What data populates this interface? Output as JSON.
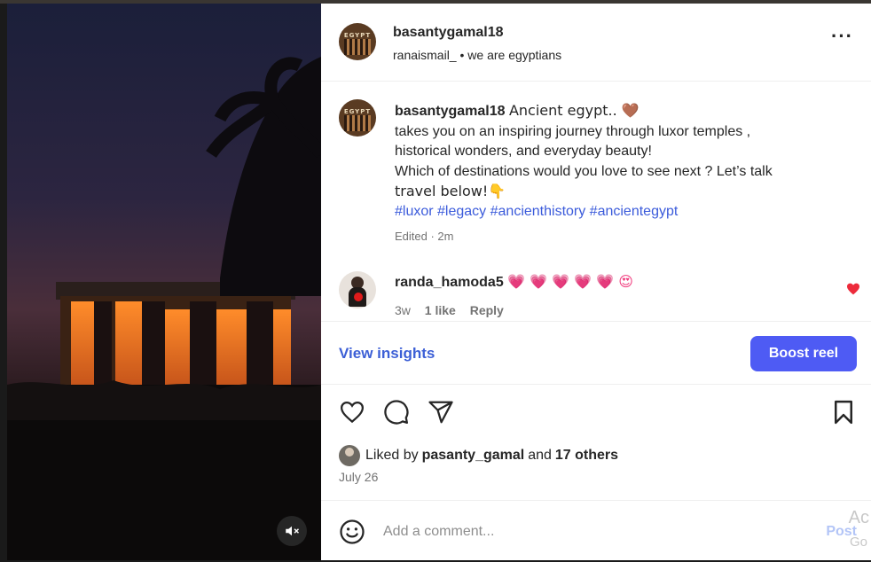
{
  "post_header": {
    "username": "basantygamal18",
    "audio_user": "ranaismail_",
    "audio_sep": "•",
    "audio_title": "we are egyptians",
    "avatar_text": "EGYPT"
  },
  "caption": {
    "username": "basantygamal18",
    "line1": "Ancient egypt.. 🤎",
    "line2": "takes you on an inspiring journey through luxor temples ,",
    "line3": "historical wonders, and everyday beauty!",
    "line4": "Which of destinations would you love to see next ? Let’s talk",
    "line5": "travel below!👇",
    "hashtags": "#luxor #legacy #ancienthistory #ancientegypt",
    "meta": "Edited · 2m"
  },
  "comment": {
    "username": "randa_hamoda5",
    "text": "💗 💗 💗 💗 💗 😍",
    "time": "3w",
    "likes": "1 like",
    "reply": "Reply"
  },
  "insights": {
    "link": "View insights",
    "boost": "Boost reel"
  },
  "likes": {
    "prefix": "Liked by",
    "user": "pasanty_gamal",
    "and": "and",
    "others": "17 others",
    "date": "July 26"
  },
  "add_comment": {
    "placeholder": "Add a comment...",
    "post": "Post",
    "overlay1": "Ac",
    "overlay2": "Go"
  },
  "colors": {
    "accent": "#4e5bf4",
    "link": "#3c5fd6",
    "like_red": "#ed2b3b"
  }
}
